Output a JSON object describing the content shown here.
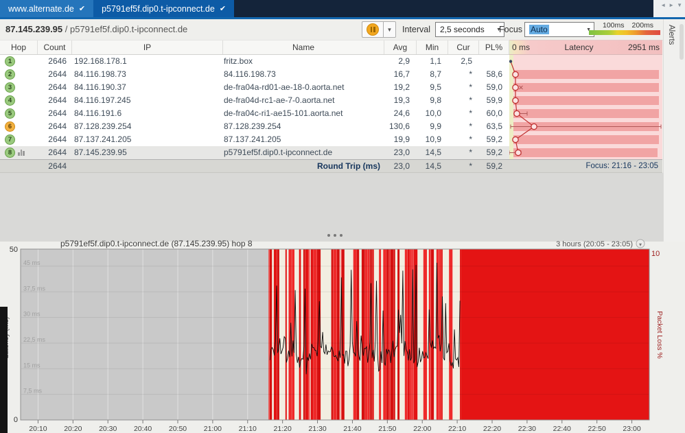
{
  "icons": {
    "check": "✔",
    "dropdown_arrow": "▼",
    "nav_left": "◄",
    "nav_right": "►",
    "nav_menu": "▼",
    "range_chevron": "▾"
  },
  "tabs": {
    "items": [
      {
        "label": "www.alternate.de",
        "active": false
      },
      {
        "label": "p5791ef5f.dip0.t-ipconnect.de",
        "active": true
      }
    ]
  },
  "toolbar": {
    "target_ip": "87.145.239.95",
    "separator": " / ",
    "target_host": "p5791ef5f.dip0.t-ipconnect.de",
    "interval_label": "Interval",
    "interval_value": "2,5 seconds",
    "focus_label": "Focus",
    "focus_value": "Auto",
    "legend_labels": [
      "100ms",
      "200ms"
    ]
  },
  "alerts_panel": {
    "label": "Alerts"
  },
  "table": {
    "columns": [
      "Hop",
      "Count",
      "IP",
      "Name",
      "Avg",
      "Min",
      "Cur",
      "PL%"
    ],
    "latency_header": {
      "min": "0 ms",
      "title": "Latency",
      "max": "2951 ms"
    },
    "rows": [
      {
        "hop": "1",
        "status": "green",
        "count": "2646",
        "ip": "192.168.178.1",
        "name": "fritz.box",
        "avg": "2,9",
        "min": "1,1",
        "cur": "2,5",
        "pl": "",
        "selected": false,
        "graph_icon": false,
        "viz": {
          "dot": 2,
          "small": true,
          "band": null,
          "whisker": null,
          "xmark": null
        }
      },
      {
        "hop": "2",
        "status": "green",
        "count": "2644",
        "ip": "84.116.198.73",
        "name": "84.116.198.73",
        "avg": "16,7",
        "min": "8,7",
        "cur": "*",
        "pl": "58,6",
        "selected": false,
        "graph_icon": false,
        "viz": {
          "dot": 9,
          "small": false,
          "band": [
            6,
            218
          ],
          "whisker": null,
          "xmark": null
        }
      },
      {
        "hop": "3",
        "status": "green",
        "count": "2644",
        "ip": "84.116.190.37",
        "name": "de-fra04a-rd01-ae-18-0.aorta.net",
        "avg": "19,2",
        "min": "9,5",
        "cur": "*",
        "pl": "59,0",
        "selected": false,
        "graph_icon": false,
        "viz": {
          "dot": 9,
          "small": false,
          "band": [
            6,
            218
          ],
          "whisker": null,
          "xmark": 17
        }
      },
      {
        "hop": "4",
        "status": "green",
        "count": "2644",
        "ip": "84.116.197.245",
        "name": "de-fra04d-rc1-ae-7-0.aorta.net",
        "avg": "19,3",
        "min": "9,8",
        "cur": "*",
        "pl": "59,9",
        "selected": false,
        "graph_icon": false,
        "viz": {
          "dot": 9,
          "small": false,
          "band": [
            6,
            218
          ],
          "whisker": null,
          "xmark": null
        }
      },
      {
        "hop": "5",
        "status": "green",
        "count": "2644",
        "ip": "84.116.191.6",
        "name": "de-fra04c-ri1-ae15-101.aorta.net",
        "avg": "24,6",
        "min": "10,0",
        "cur": "*",
        "pl": "60,0",
        "selected": false,
        "graph_icon": false,
        "viz": {
          "dot": 11,
          "small": false,
          "band": [
            6,
            218
          ],
          "whisker": [
            11,
            26
          ],
          "xmark": null
        }
      },
      {
        "hop": "6",
        "status": "orange",
        "count": "2644",
        "ip": "87.128.239.254",
        "name": "87.128.239.254",
        "avg": "130,6",
        "min": "9,9",
        "cur": "*",
        "pl": "63,5",
        "selected": false,
        "graph_icon": false,
        "viz": {
          "dot": 36,
          "small": false,
          "band": [
            6,
            218
          ],
          "whisker": [
            2,
            221
          ],
          "xmark": null
        }
      },
      {
        "hop": "7",
        "status": "green",
        "count": "2644",
        "ip": "87.137.241.205",
        "name": "87.137.241.205",
        "avg": "19,9",
        "min": "10,9",
        "cur": "*",
        "pl": "59,2",
        "selected": false,
        "graph_icon": false,
        "viz": {
          "dot": 9,
          "small": false,
          "band": [
            6,
            218
          ],
          "whisker": null,
          "xmark": null
        }
      },
      {
        "hop": "8",
        "status": "green",
        "count": "2644",
        "ip": "87.145.239.95",
        "name": "p5791ef5f.dip0.t-ipconnect.de",
        "avg": "23,0",
        "min": "14,5",
        "cur": "*",
        "pl": "59,2",
        "selected": true,
        "graph_icon": true,
        "viz": {
          "dot": 13,
          "small": false,
          "band": [
            6,
            216
          ],
          "whisker": [
            0,
            17
          ],
          "xmark": null
        }
      }
    ],
    "summary": {
      "count": "2644",
      "label": "Round Trip (ms)",
      "avg": "23,0",
      "min": "14,5",
      "cur": "*",
      "pl": "59,2",
      "focus_label": "Focus: 21:16 - 23:05"
    }
  },
  "graph_header": {
    "title": "p5791ef5f.dip0.t-ipconnect.de (87.145.239.95) hop 8",
    "range_label": "3 hours (20:05 - 23:05)"
  },
  "chart_data": {
    "type": "line",
    "title": "p5791ef5f.dip0.t-ipconnect.de (87.145.239.95) hop 8",
    "time_range": {
      "start": "20:05",
      "end": "23:05"
    },
    "x_ticks": [
      "20:10",
      "20:20",
      "20:30",
      "20:40",
      "20:50",
      "21:00",
      "21:10",
      "21:20",
      "21:30",
      "21:40",
      "21:50",
      "22:00",
      "22:10",
      "22:20",
      "22:30",
      "22:40",
      "22:50",
      "23:00"
    ],
    "y_left": {
      "label": "Latency (ms)",
      "min": 0,
      "max": 50,
      "top_label": "50",
      "bottom_label": "0",
      "gridline_values": [
        45,
        37.5,
        30,
        22.5,
        15,
        7.5
      ],
      "gridline_labels": [
        "45 ms",
        "37,5 ms",
        "30 ms",
        "22,5 ms",
        "15 ms",
        "7,5 ms"
      ]
    },
    "y_right": {
      "label": "Packet Loss %",
      "min": 0,
      "max": 10,
      "top_label": "10"
    },
    "segments": [
      {
        "from": "20:05",
        "to": "21:16",
        "state": "no-data",
        "color": "#c9c9c9"
      },
      {
        "from": "21:16",
        "to": "22:11",
        "state": "intermittent-loss",
        "color": "#e21414"
      },
      {
        "from": "22:11",
        "to": "23:05",
        "state": "total-loss",
        "color": "#e41414"
      }
    ],
    "latency_trace": {
      "from": "21:16",
      "to": "22:11",
      "base_ms": 19,
      "min_ms": 13,
      "spike_ms": 46,
      "color": "#0a0a0a"
    }
  },
  "colors": {
    "tab_active": "#0d5ba6",
    "tab_inactive": "#2575bb",
    "accent_line": "#1266ae",
    "loss_red": "#e21414",
    "plot_bg": "#c9c9c9",
    "band_pink": "#f1a4a4",
    "cell_pink": "#fadada",
    "hop_green": "#9aca7e",
    "hop_orange": "#f3b13f"
  }
}
